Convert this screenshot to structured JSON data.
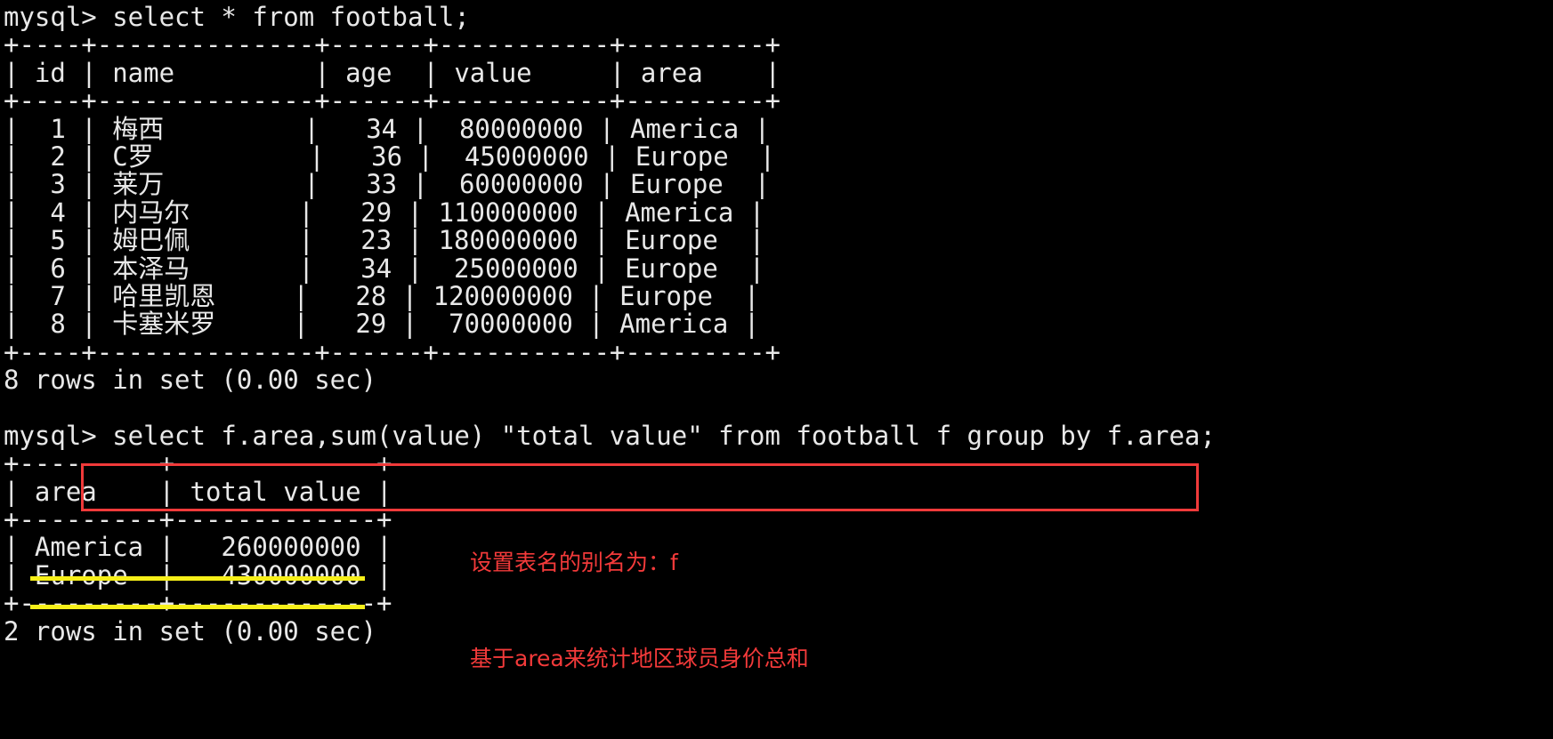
{
  "terminal": {
    "prompt": "mysql>",
    "colors": {
      "background": "#000000",
      "foreground": "#e8e8e8",
      "annotation_red": "#f33a3a",
      "box_red": "#f03a3a",
      "underline_yellow": "#f7f019"
    }
  },
  "query1": {
    "command_line": "mysql> select * from football;",
    "sql": "select * from football;",
    "border_top": "+----+--------------+------+-----------+---------+",
    "header_line": "| id | name         | age  | value     | area    |",
    "border_mid": "+----+--------------+------+-----------+---------+",
    "rows_text": [
      "|  1 | 梅西         |   34 |  80000000 | America |",
      "|  2 | C罗          |   36 |  45000000 | Europe  |",
      "|  3 | 莱万         |   33 |  60000000 | Europe  |",
      "|  4 | 内马尔       |   29 | 110000000 | America |",
      "|  5 | 姆巴佩       |   23 | 180000000 | Europe  |",
      "|  6 | 本泽马       |   34 |  25000000 | Europe  |",
      "|  7 | 哈里凯恩     |   28 | 120000000 | Europe  |",
      "|  8 | 卡塞米罗     |   29 |  70000000 | America |"
    ],
    "border_bottom": "+----+--------------+------+-----------+---------+",
    "status": "8 rows in set (0.00 sec)",
    "columns": [
      "id",
      "name",
      "age",
      "value",
      "area"
    ],
    "rows": [
      {
        "id": "1",
        "name": "梅西",
        "age": "34",
        "value": "80000000",
        "area": "America"
      },
      {
        "id": "2",
        "name": "C罗",
        "age": "36",
        "value": "45000000",
        "area": "Europe"
      },
      {
        "id": "3",
        "name": "莱万",
        "age": "33",
        "value": "60000000",
        "area": "Europe"
      },
      {
        "id": "4",
        "name": "内马尔",
        "age": "29",
        "value": "110000000",
        "area": "America"
      },
      {
        "id": "5",
        "name": "姆巴佩",
        "age": "23",
        "value": "180000000",
        "area": "Europe"
      },
      {
        "id": "6",
        "name": "本泽马",
        "age": "34",
        "value": "25000000",
        "area": "Europe"
      },
      {
        "id": "7",
        "name": "哈里凯恩",
        "age": "28",
        "value": "120000000",
        "area": "Europe"
      },
      {
        "id": "8",
        "name": "卡塞米罗",
        "age": "29",
        "value": "70000000",
        "area": "America"
      }
    ],
    "row_count": "8"
  },
  "query2": {
    "command_line": "mysql> select f.area,sum(value) \"total value\" from football f group by f.area;",
    "sql": "select f.area,sum(value) \"total value\" from football f group by f.area;",
    "border_top": "+---------+-------------+",
    "header_line": "| area    | total value |",
    "border_mid": "+---------+-------------+",
    "rows_text": [
      "| America |   260000000 |",
      "| Europe  |   430000000 |"
    ],
    "border_bottom": "+---------+-------------+",
    "status": "2 rows in set (0.00 sec)",
    "columns": [
      "area",
      "total value"
    ],
    "rows": [
      {
        "area": "America",
        "total_value": "260000000"
      },
      {
        "area": "Europe",
        "total_value": "430000000"
      }
    ],
    "row_count": "2"
  },
  "annotations": {
    "note1": "设置表名的别名为：f",
    "note2": "基于area来统计地区球员身价总和"
  }
}
